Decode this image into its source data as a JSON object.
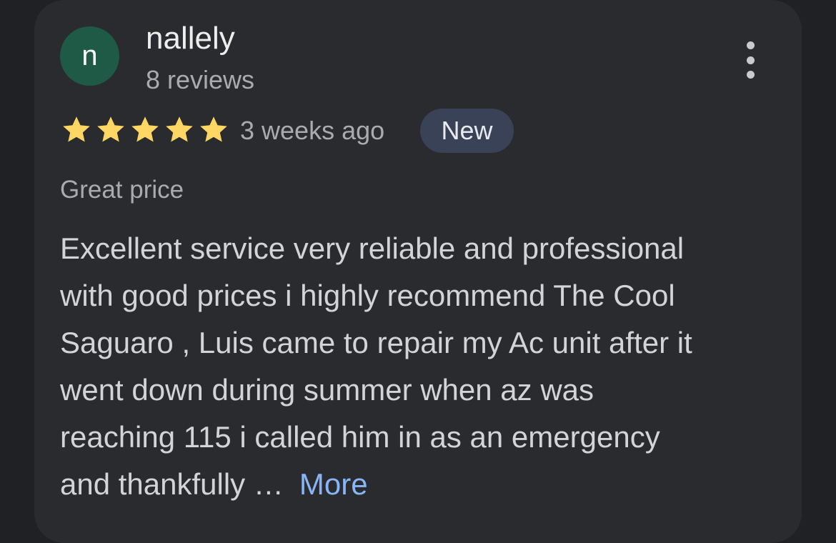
{
  "reviewer": {
    "initial": "n",
    "name": "nallely",
    "review_count": "8 reviews",
    "avatar_color": "#1e5a46"
  },
  "rating": {
    "stars": 5,
    "max": 5,
    "star_color": "#fdd663"
  },
  "time_ago": "3 weeks ago",
  "badge": "New",
  "tag": "Great price",
  "review_lines": [
    "Excellent service very reliable and professional",
    "with good prices i highly recommend The Cool",
    "Saguaro , Luis came to repair my Ac unit after it",
    "went down during summer when az was",
    "reaching 115 i called him in as an emergency",
    "and thankfully …"
  ],
  "more_link": "More",
  "menu_icon": "more-vert-icon",
  "colors": {
    "background": "#202124",
    "card": "#2a2b2e",
    "link": "#8ab4f8",
    "badge_bg": "#3a4257"
  }
}
